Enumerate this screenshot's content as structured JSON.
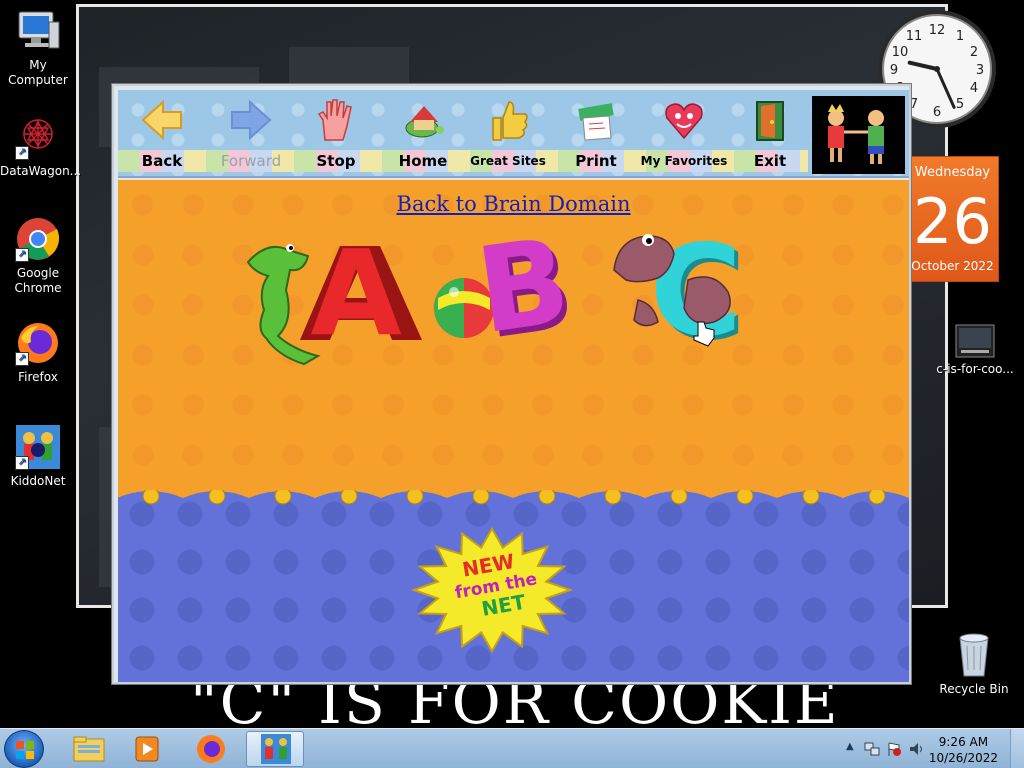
{
  "desktop": {
    "icons": [
      {
        "label": "My Computer"
      },
      {
        "label": "DataWagon..."
      },
      {
        "label": "Google Chrome"
      },
      {
        "label": "Firefox"
      },
      {
        "label": "KiddoNet"
      },
      {
        "label": "c-is-for-coo..."
      },
      {
        "label": "Recycle Bin"
      }
    ],
    "video_caption": "\"C\" IS FOR COOKIE"
  },
  "gadgets": {
    "calendar": {
      "weekday": "Wednesday",
      "day": "26",
      "month_year": "October 2022"
    },
    "clock": {
      "hour": 9,
      "minute": 26
    }
  },
  "kiddonet": {
    "toolbar": [
      {
        "label": "Back",
        "icon": "back-arrow-icon",
        "enabled": true
      },
      {
        "label": "Forward",
        "icon": "forward-arrow-icon",
        "enabled": false
      },
      {
        "label": "Stop",
        "icon": "stop-hand-icon",
        "enabled": true
      },
      {
        "label": "Home",
        "icon": "home-turtle-icon",
        "enabled": true
      },
      {
        "label": "Great Sites",
        "icon": "thumbs-up-icon",
        "enabled": true
      },
      {
        "label": "Print",
        "icon": "print-icon",
        "enabled": true
      },
      {
        "label": "My Favorites",
        "icon": "heart-face-icon",
        "enabled": true
      },
      {
        "label": "Exit",
        "icon": "exit-door-icon",
        "enabled": true
      }
    ],
    "page": {
      "back_link": "Back to Brain Domain",
      "abc_letters": [
        "A",
        "B",
        "C"
      ],
      "badge": {
        "line1": "NEW",
        "line2": "from the",
        "line3": "NET"
      }
    }
  },
  "taskbar": {
    "time": "9:26 AM",
    "date": "10/26/2022"
  },
  "colors": {
    "orange_bg": "#f5a02a",
    "blue_bg": "#6272d8",
    "letter_a": "#e8282a",
    "letter_b": "#d23cc8",
    "letter_c": "#30d4d8",
    "badge_yellow": "#f4ea2a"
  }
}
